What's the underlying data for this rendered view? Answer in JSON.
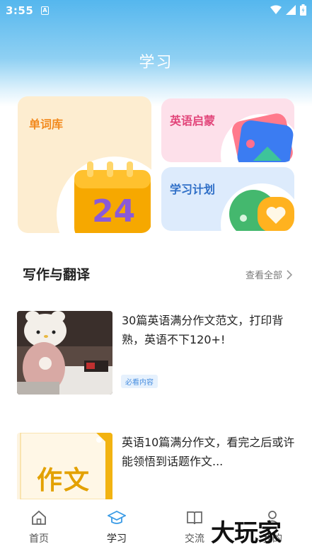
{
  "status_bar": {
    "time": "3:55",
    "notification_icon": "A"
  },
  "header": {
    "title": "学习"
  },
  "feature_cards": {
    "vocab": {
      "title": "单词库",
      "calendar_number": "24"
    },
    "enlightenment": {
      "title": "英语启蒙"
    },
    "plan": {
      "title": "学习计划"
    }
  },
  "section": {
    "title": "写作与翻译",
    "view_all": "查看全部"
  },
  "articles": [
    {
      "title": "30篇英语满分作文范文，打印背熟，英语不下120+!",
      "tag": "必看内容"
    },
    {
      "title": "英语10篇满分作文，看完之后或许能领悟到话题作文...",
      "thumb_text": "作文"
    }
  ],
  "tab_bar": {
    "tabs": [
      {
        "label": "首页",
        "icon": "home-icon"
      },
      {
        "label": "学习",
        "icon": "graduation-cap-icon"
      },
      {
        "label": "交流",
        "icon": "book-icon"
      },
      {
        "label": "我的",
        "icon": "profile-icon"
      }
    ],
    "active": "学习"
  },
  "watermark": "大玩家",
  "colors": {
    "accent": "#4aa8e8",
    "vocab_title": "#f28a1e",
    "enlight_title": "#e2457a",
    "plan_title": "#2f6fc7"
  }
}
